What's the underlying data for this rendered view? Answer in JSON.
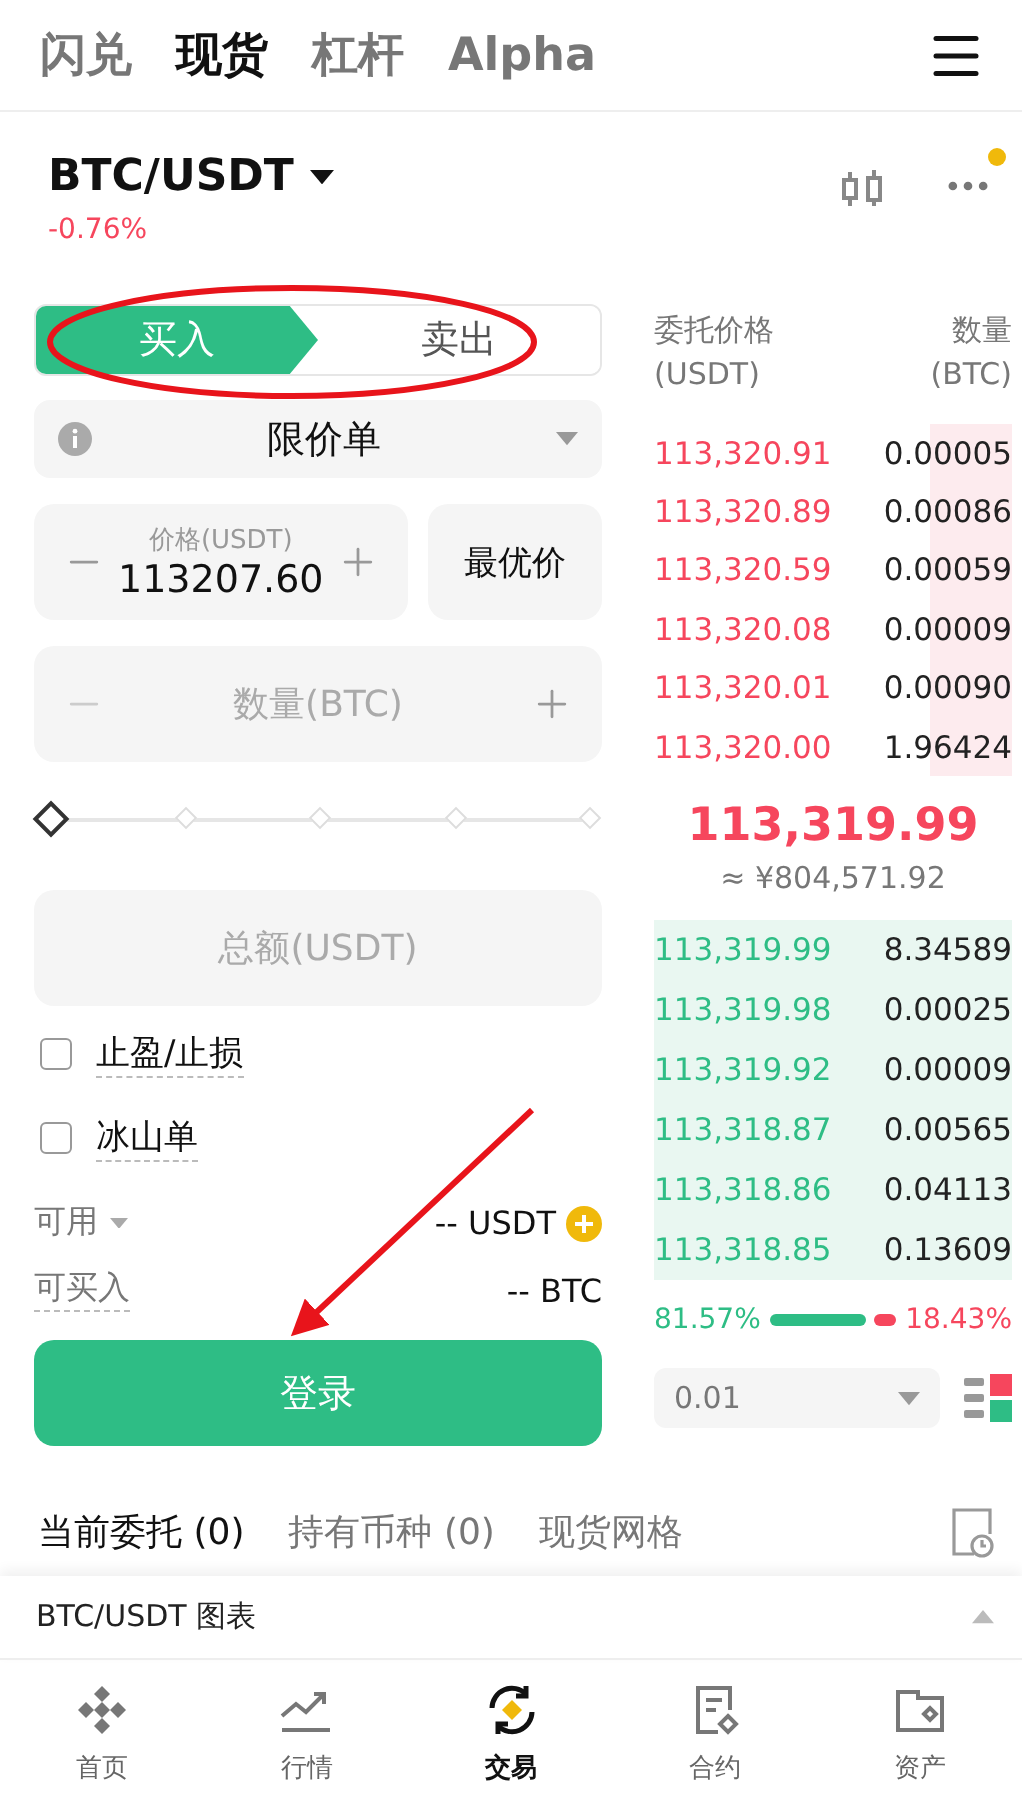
{
  "top_tabs": [
    {
      "label": "闪兑",
      "selected": false
    },
    {
      "label": "现货",
      "selected": true
    },
    {
      "label": "杠杆",
      "selected": false
    },
    {
      "label": "Alpha",
      "selected": false
    }
  ],
  "pair": {
    "symbol": "BTC/USDT",
    "change": "-0.76%",
    "has_notification": true
  },
  "side_tabs": [
    {
      "label": "买入",
      "selected": true
    },
    {
      "label": "卖出",
      "selected": false
    }
  ],
  "order_type": {
    "value": "限价单"
  },
  "price_field": {
    "label": "价格(USDT)",
    "value": "113207.60"
  },
  "best_price_button": "最优价",
  "quantity_field": {
    "placeholder": "数量(BTC)"
  },
  "slider": {
    "level": 0
  },
  "total_field": {
    "placeholder": "总额(USDT)"
  },
  "options": [
    {
      "label": "止盈/止损",
      "checked": false
    },
    {
      "label": "冰山单",
      "checked": false
    }
  ],
  "available": {
    "label": "可用",
    "value": "-- USDT"
  },
  "buyable": {
    "label": "可买入",
    "value": "-- BTC"
  },
  "login_button": "登录",
  "order_book": {
    "price_header": "委托价格",
    "price_unit": "(USDT)",
    "amount_header": "数量",
    "amount_unit": "(BTC)",
    "asks": [
      {
        "price": "113,320.91",
        "amount": "0.00005"
      },
      {
        "price": "113,320.89",
        "amount": "0.00086"
      },
      {
        "price": "113,320.59",
        "amount": "0.00059"
      },
      {
        "price": "113,320.08",
        "amount": "0.00009"
      },
      {
        "price": "113,320.01",
        "amount": "0.00090"
      },
      {
        "price": "113,320.00",
        "amount": "1.96424"
      }
    ],
    "last_price": "113,319.99",
    "last_price_cny": "≈ ¥804,571.92",
    "bids": [
      {
        "price": "113,319.99",
        "amount": "8.34589"
      },
      {
        "price": "113,319.98",
        "amount": "0.00025"
      },
      {
        "price": "113,319.92",
        "amount": "0.00009"
      },
      {
        "price": "113,318.87",
        "amount": "0.00565"
      },
      {
        "price": "113,318.86",
        "amount": "0.04113"
      },
      {
        "price": "113,318.85",
        "amount": "0.13609"
      }
    ],
    "buy_ratio": "81.57%",
    "sell_ratio": "18.43%",
    "precision": "0.01"
  },
  "bottom_tabs": [
    {
      "label": "当前委托 (0)",
      "selected": true
    },
    {
      "label": "持有币种 (0)",
      "selected": false
    },
    {
      "label": "现货网格",
      "selected": false
    }
  ],
  "chart_bar": {
    "label": "BTC/USDT 图表"
  },
  "nav": [
    {
      "label": "首页",
      "selected": false
    },
    {
      "label": "行情",
      "selected": false
    },
    {
      "label": "交易",
      "selected": true
    },
    {
      "label": "合约",
      "selected": false
    },
    {
      "label": "资产",
      "selected": false
    }
  ]
}
